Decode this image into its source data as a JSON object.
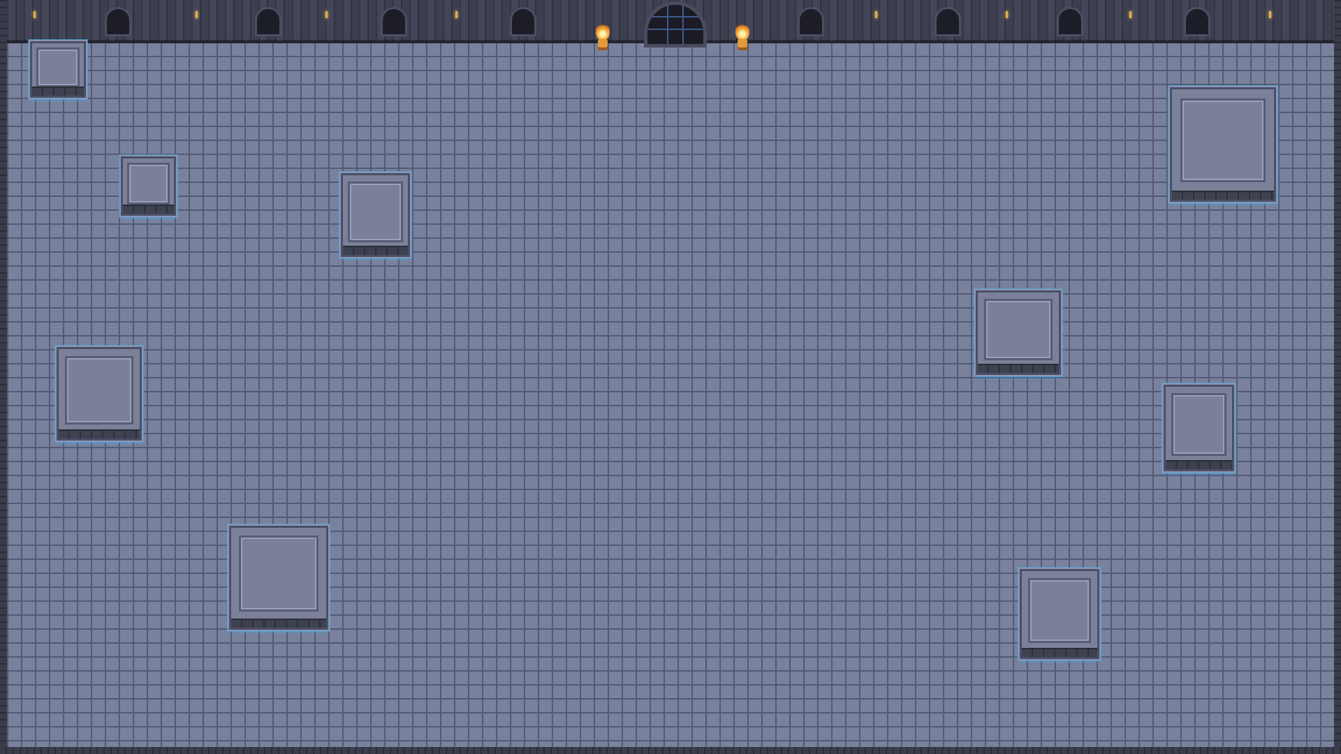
{
  "scene": {
    "name": "dungeon-room",
    "colors": {
      "floor": "#7a819c",
      "grid": "#525a75",
      "wall": "#3b3d4c",
      "block": "#7c819a",
      "glow": "#46b4f0",
      "flame": "#f6b74a"
    }
  },
  "wall": {
    "icons": {
      "niche": "arched-alcove-icon",
      "candle": "candle-icon",
      "torch": "torch-icon",
      "gate": "portcullis-gate-icon"
    }
  },
  "blocks": [
    {
      "id": "block-1"
    },
    {
      "id": "block-2"
    },
    {
      "id": "block-3"
    },
    {
      "id": "block-4"
    },
    {
      "id": "block-5"
    },
    {
      "id": "block-6"
    },
    {
      "id": "block-7"
    },
    {
      "id": "block-8"
    },
    {
      "id": "block-9"
    },
    {
      "id": "block-10"
    }
  ]
}
